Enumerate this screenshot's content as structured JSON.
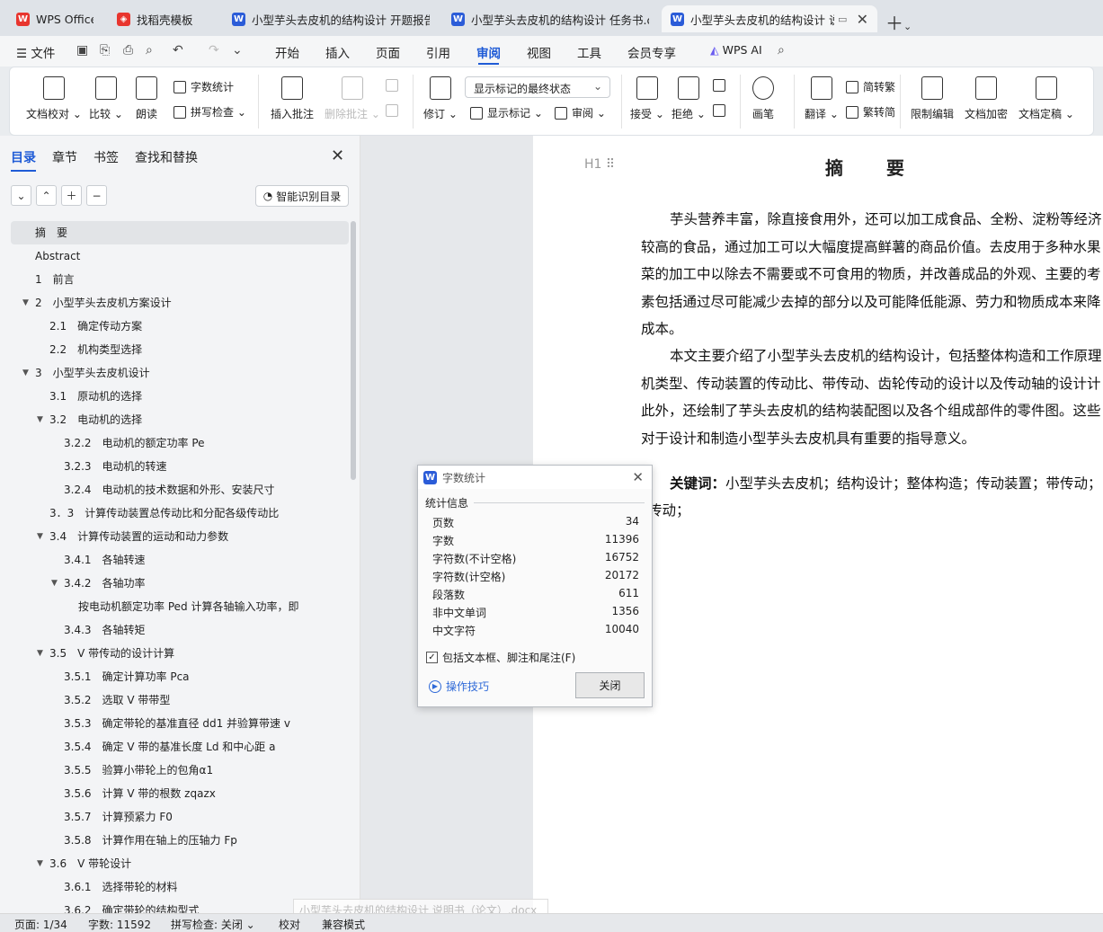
{
  "tabs": [
    {
      "label": "WPS Office",
      "icon": "wps-logo"
    },
    {
      "label": "找稻壳模板",
      "icon": "docer-icon"
    },
    {
      "label": "小型芋头去皮机的结构设计 开题报告",
      "icon": "word-doc-icon"
    },
    {
      "label": "小型芋头去皮机的结构设计 任务书.dc",
      "icon": "word-doc-icon"
    },
    {
      "label": "小型芋头去皮机的结构设计 说",
      "icon": "word-doc-icon"
    }
  ],
  "menu": {
    "file": "文件",
    "items": [
      "开始",
      "插入",
      "页面",
      "引用",
      "审阅",
      "视图",
      "工具",
      "会员专享"
    ],
    "ai": "WPS AI"
  },
  "ribbon": {
    "proofread": "文档校对",
    "compare": "比较",
    "read_aloud": "朗读",
    "word_count": "字数统计",
    "spell_check": "拼写检查",
    "insert_comment": "插入批注",
    "delete_comment": "删除批注",
    "revise": "修订",
    "markup_state": "显示标记的最终状态",
    "show_markup": "显示标记",
    "review_pane": "审阅",
    "accept": "接受",
    "reject": "拒绝",
    "pen": "画笔",
    "translate": "翻译",
    "to_traditional": "简转繁",
    "to_simplified": "繁转简",
    "restrict_edit": "限制编辑",
    "encrypt": "文档加密",
    "finalize": "文档定稿"
  },
  "nav": {
    "tabs": [
      "目录",
      "章节",
      "书签",
      "查找和替换"
    ],
    "smart_btn": "智能识别目录",
    "toc": [
      {
        "label": "摘　要",
        "level": 0,
        "arrow": ""
      },
      {
        "label": "Abstract",
        "level": 0,
        "arrow": ""
      },
      {
        "label": "1　前言",
        "level": 0,
        "arrow": ""
      },
      {
        "label": "2　小型芋头去皮机方案设计",
        "level": 0,
        "arrow": "▼"
      },
      {
        "label": "2.1　确定传动方案",
        "level": 1,
        "arrow": ""
      },
      {
        "label": "2.2　机构类型选择",
        "level": 1,
        "arrow": ""
      },
      {
        "label": "3　小型芋头去皮机设计",
        "level": 0,
        "arrow": "▼"
      },
      {
        "label": "3.1　原动机的选择",
        "level": 1,
        "arrow": ""
      },
      {
        "label": "3.2　电动机的选择",
        "level": 1,
        "arrow": "▼"
      },
      {
        "label": "3.2.2　电动机的额定功率 Pe",
        "level": 2,
        "arrow": ""
      },
      {
        "label": "3.2.3　电动机的转速",
        "level": 2,
        "arrow": ""
      },
      {
        "label": "3.2.4　电动机的技术数据和外形、安装尺寸",
        "level": 2,
        "arrow": ""
      },
      {
        "label": "3．3　计算传动装置总传动比和分配各级传动比",
        "level": 1,
        "arrow": ""
      },
      {
        "label": "3.4　计算传动装置的运动和动力参数",
        "level": 1,
        "arrow": "▼"
      },
      {
        "label": "3.4.1　各轴转速",
        "level": 2,
        "arrow": ""
      },
      {
        "label": "3.4.2　各轴功率",
        "level": 2,
        "arrow": "▼"
      },
      {
        "label": "按电动机额定功率 Ped 计算各轴输入功率，即",
        "level": 3,
        "arrow": ""
      },
      {
        "label": "3.4.3　各轴转矩",
        "level": 2,
        "arrow": ""
      },
      {
        "label": "3.5　V 带传动的设计计算",
        "level": 1,
        "arrow": "▼"
      },
      {
        "label": "3.5.1　确定计算功率 Pca",
        "level": 2,
        "arrow": ""
      },
      {
        "label": "3.5.2　选取 V 带带型",
        "level": 2,
        "arrow": ""
      },
      {
        "label": "3.5.3　确定带轮的基准直径 dd1 并验算带速 v",
        "level": 2,
        "arrow": ""
      },
      {
        "label": "3.5.4　确定 V 带的基准长度 Ld 和中心距 a",
        "level": 2,
        "arrow": ""
      },
      {
        "label": "3.5.5　验算小带轮上的包角α1",
        "level": 2,
        "arrow": ""
      },
      {
        "label": "3.5.6　计算 V 带的根数 zqazx",
        "level": 2,
        "arrow": ""
      },
      {
        "label": "3.5.7　计算预紧力 F0",
        "level": 2,
        "arrow": ""
      },
      {
        "label": "3.5.8　计算作用在轴上的压轴力 Fp",
        "level": 2,
        "arrow": ""
      },
      {
        "label": "3.6　V 带轮设计",
        "level": 1,
        "arrow": "▼"
      },
      {
        "label": "3.6.1　选择带轮的材料",
        "level": 2,
        "arrow": ""
      },
      {
        "label": "3.6.2　确定带轮的结构型式",
        "level": 2,
        "arrow": ""
      }
    ]
  },
  "doc": {
    "heading_tag": "H1",
    "title": "摘　要",
    "para1": [
      "芋头营养丰富，除直接食用外，还可以加工成食品、全粉、淀粉等经济",
      "较高的食品，通过加工可以大幅度提高鲜薯的商品价值。去皮用于多种水果",
      "菜的加工中以除去不需要或不可食用的物质，并改善成品的外观、主要的考",
      "素包括通过尽可能减少去掉的部分以及可能降低能源、劳力和物质成本来降",
      "成本。"
    ],
    "para2": [
      "本文主要介绍了小型芋头去皮机的结构设计，包括整体构造和工作原理",
      "机类型、传动装置的传动比、带传动、齿轮传动的设计以及传动轴的设计计",
      "此外，还绘制了芋头去皮机的结构装配图以及各个组成部件的零件图。这些",
      "对于设计和制造小型芋头去皮机具有重要的指导意义。"
    ],
    "keywords_label": "关键词：",
    "keywords": "小型芋头去皮机；结构设计；整体构造；传动装置；带传动；",
    "keywords_cont": "传动；"
  },
  "dialog": {
    "title": "字数统计",
    "section": "统计信息",
    "rows": [
      {
        "label": "页数",
        "value": "34"
      },
      {
        "label": "字数",
        "value": "11396"
      },
      {
        "label": "字符数(不计空格)",
        "value": "16752"
      },
      {
        "label": "字符数(计空格)",
        "value": "20172"
      },
      {
        "label": "段落数",
        "value": "611"
      },
      {
        "label": "非中文单词",
        "value": "1356"
      },
      {
        "label": "中文字符",
        "value": "10040"
      }
    ],
    "checkbox": "包括文本框、脚注和尾注(F)",
    "checked": true,
    "tips": "操作技巧",
    "close": "关闭"
  },
  "status": {
    "page": "页面: 1/34",
    "words": "字数: 11592",
    "spell": "拼写检查: 关闭",
    "proof": "校对",
    "compat": "兼容模式"
  },
  "tooltip": "小型芋头去皮机的结构设计 说明书（论文）.docx",
  "colors": {
    "accent": "#1f5bd6",
    "wps_red": "#e8352e",
    "doc_blue": "#2b5cd8"
  }
}
